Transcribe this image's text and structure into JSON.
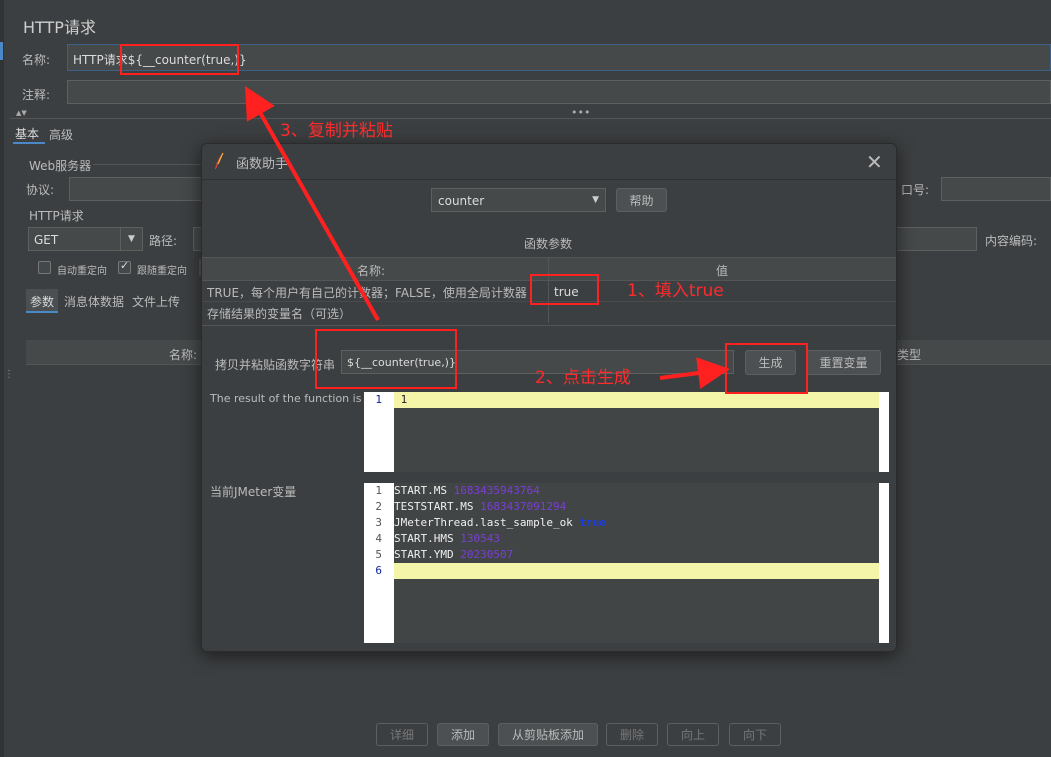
{
  "main": {
    "title": "HTTP请求",
    "name_label": "名称:",
    "name_value": "HTTP请求${__counter(true,)}",
    "comment_label": "注释:",
    "tabs": [
      "基本",
      "高级"
    ],
    "web_server_label": "Web服务器",
    "protocol_label": "协议:",
    "port_label": "口号:",
    "http_request_label": "HTTP请求",
    "method_value": "GET",
    "path_label": "路径:",
    "encoding_label": "内容编码:",
    "checkboxes": [
      {
        "label": "自动重定向",
        "checked": false
      },
      {
        "label": "跟随重定向",
        "checked": true
      }
    ],
    "subtabs": [
      "参数",
      "消息体数据",
      "文件上传"
    ],
    "table_header_name": "名称:",
    "table_header_type": "类型",
    "bottom_buttons": [
      {
        "label": "详细",
        "enabled": false
      },
      {
        "label": "添加",
        "enabled": true
      },
      {
        "label": "从剪贴板添加",
        "enabled": true
      },
      {
        "label": "删除",
        "enabled": false
      },
      {
        "label": "向上",
        "enabled": false
      },
      {
        "label": "向下",
        "enabled": false
      }
    ]
  },
  "dialog": {
    "title": "函数助手",
    "function_select": "counter",
    "help_button": "帮助",
    "params_title": "函数参数",
    "col_name": "名称:",
    "col_value": "值",
    "params": [
      {
        "name": "TRUE，每个用户有自己的计数器；FALSE，使用全局计数器",
        "value": "true"
      },
      {
        "name": "存储结果的变量名（可选）",
        "value": ""
      }
    ],
    "copy_label": "拷贝并粘贴函数字符串",
    "copy_value": "${__counter(true,)}",
    "generate_button": "生成",
    "reset_button": "重置变量",
    "result_label": "The result of the function is",
    "result_lines": [
      "1"
    ],
    "vars_label": "当前JMeter变量",
    "vars_lines": [
      {
        "key": "START.MS",
        "value": "1683435943764"
      },
      {
        "key": "TESTSTART.MS",
        "value": "1683437091294"
      },
      {
        "key": "JMeterThread.last_sample_ok",
        "value": "true"
      },
      {
        "key": "START.HMS",
        "value": "130543"
      },
      {
        "key": "START.YMD",
        "value": "20230507"
      },
      {
        "key": "",
        "value": ""
      }
    ],
    "line_numbers_result": [
      "1"
    ],
    "line_numbers_vars": [
      "1",
      "2",
      "3",
      "4",
      "5",
      "6"
    ]
  },
  "annotations": {
    "step1": "1、填入true",
    "step2": "2、点击生成",
    "step3": "3、复制并粘贴",
    "color": "#ff2020"
  },
  "colors": {
    "background": "#3c3f41",
    "field": "#45494a",
    "current_line": "#ffffb0",
    "number_purple": "#7a3ed3",
    "keyword_blue": "#1a3bd6"
  }
}
